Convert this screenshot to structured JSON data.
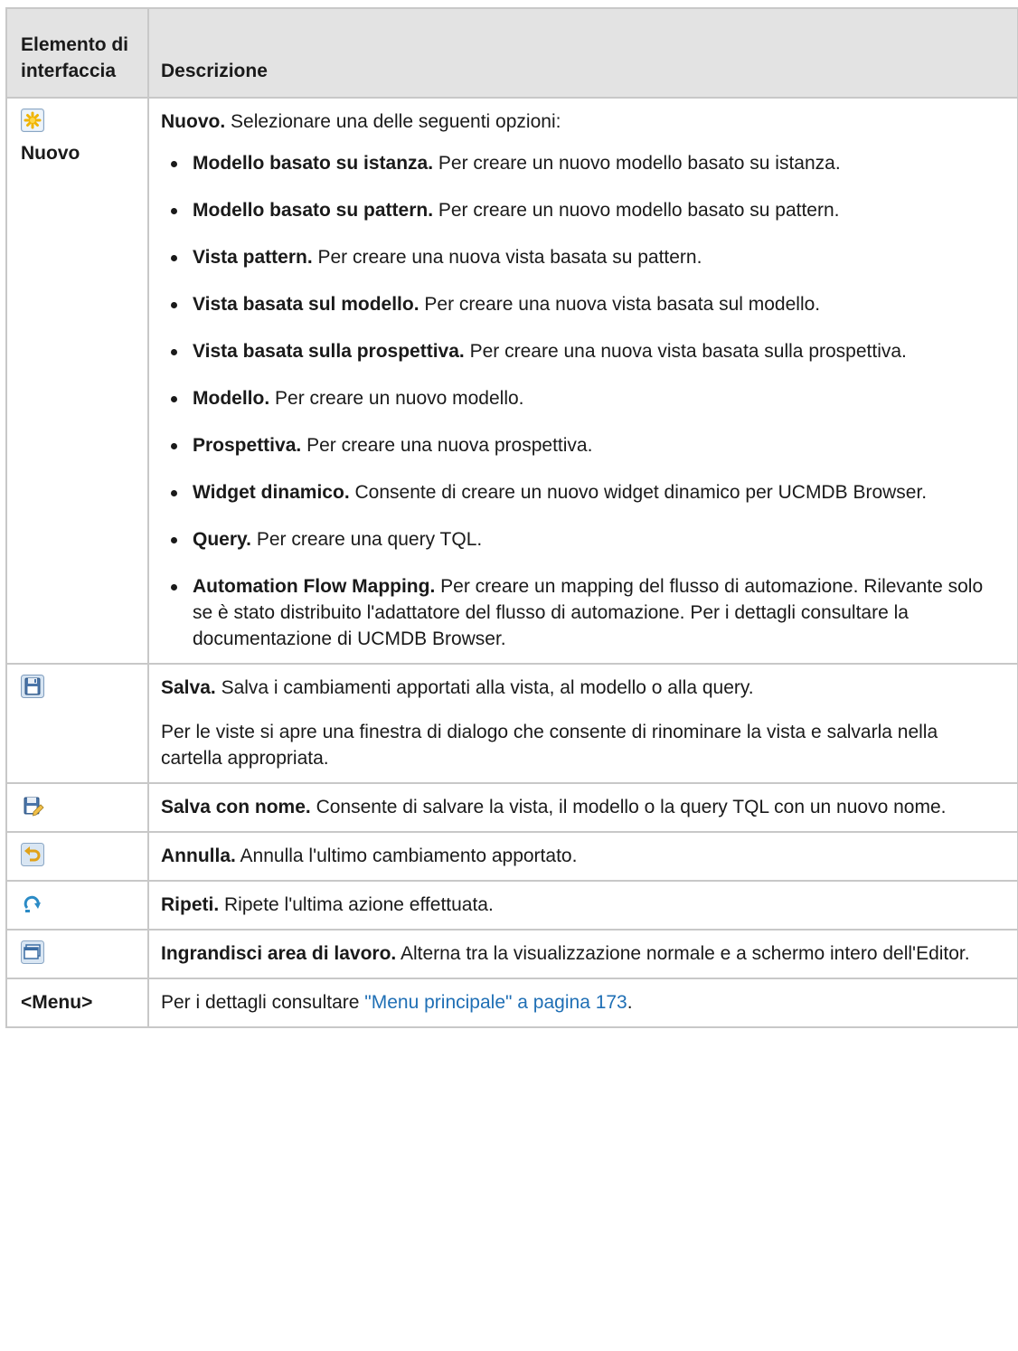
{
  "header": {
    "col1": "Elemento di interfaccia",
    "col2": "Descrizione"
  },
  "rows": {
    "new": {
      "icon": "new-star-icon",
      "label": "Nuovo",
      "title": "Nuovo.",
      "intro": "Selezionare una delle seguenti opzioni:",
      "options": [
        {
          "name": "Modello basato su istanza.",
          "text": "Per creare un nuovo modello basato su istanza."
        },
        {
          "name": "Modello basato su pattern.",
          "text": "Per creare un nuovo modello basato su pattern."
        },
        {
          "name": "Vista pattern.",
          "text": "Per creare una nuova vista basata su pattern."
        },
        {
          "name": "Vista basata sul modello.",
          "text": "Per creare una nuova vista basata sul modello."
        },
        {
          "name": "Vista basata sulla prospettiva.",
          "text": "Per creare una nuova vista basata sulla prospettiva."
        },
        {
          "name": "Modello.",
          "text": "Per creare un nuovo modello."
        },
        {
          "name": "Prospettiva.",
          "text": "Per creare una nuova prospettiva."
        },
        {
          "name": "Widget dinamico.",
          "text": "Consente di creare un nuovo widget dinamico per UCMDB Browser."
        },
        {
          "name": "Query.",
          "text": "Per creare una query TQL."
        },
        {
          "name": "Automation Flow Mapping.",
          "text": "Per creare un mapping del flusso di automazione. Rilevante solo se è stato distribuito l'adattatore del flusso di automazione. Per i dettagli consultare la documentazione di UCMDB Browser."
        }
      ]
    },
    "save": {
      "icon": "save-disk-icon",
      "title": "Salva.",
      "text": "Salva i cambiamenti apportati alla vista, al modello o alla query.",
      "extra": "Per le viste si apre una finestra di dialogo che consente di rinominare la vista e salvarla nella cartella appropriata."
    },
    "save_as": {
      "icon": "save-as-icon",
      "title": "Salva con nome.",
      "text": "Consente di salvare la vista, il modello o la query TQL con un nuovo nome."
    },
    "undo": {
      "icon": "undo-icon",
      "title": "Annulla.",
      "text": "Annulla l'ultimo cambiamento apportato."
    },
    "redo": {
      "icon": "redo-icon",
      "title": "Ripeti.",
      "text": "Ripete l'ultima azione effettuata."
    },
    "maximize": {
      "icon": "maximize-workarea-icon",
      "title": "Ingrandisci area di lavoro.",
      "text": "Alterna tra la visualizzazione normale e a schermo intero dell'Editor."
    },
    "menu": {
      "label": "<Menu>",
      "text_before": "Per i dettagli consultare ",
      "link": "\"Menu principale\" a pagina 173",
      "text_after": "."
    }
  }
}
